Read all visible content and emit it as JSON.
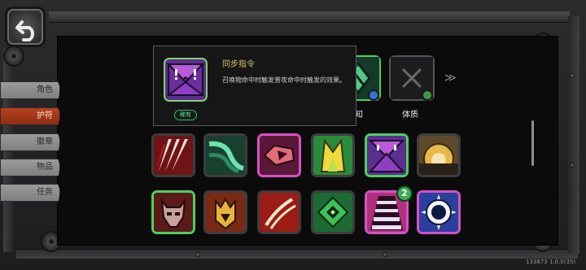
{
  "nav": {
    "tabs": [
      {
        "label": "角色",
        "active": false
      },
      {
        "label": "护符",
        "active": true
      },
      {
        "label": "徽章",
        "active": false
      },
      {
        "label": "物品",
        "active": false
      },
      {
        "label": "任务",
        "active": false
      }
    ]
  },
  "tooltip": {
    "title": "同步指令",
    "description": "召唤物命中时触发普攻命中时触发的效果。",
    "rarity": "稀有",
    "icon": "purple-alert-triangles-icon"
  },
  "top_row": [
    {
      "label": "感知",
      "icon": "green-crystal-icon",
      "badge_icon": "blue-gem-icon"
    },
    {
      "label": "体质",
      "icon": "empty-cross-icon",
      "badge_icon": "green-shield-icon"
    }
  ],
  "grid": {
    "rows": [
      [
        {
          "name": "red-claw-slash-icon",
          "border": "gray"
        },
        {
          "name": "green-dash-icon",
          "border": "gray"
        },
        {
          "name": "pink-burst-fist-icon",
          "border": "pink"
        },
        {
          "name": "yellow-arrows-icon",
          "border": "gray"
        },
        {
          "name": "purple-alert-triangles-icon",
          "border": "green"
        },
        {
          "name": "golden-sun-icon",
          "border": "gray"
        }
      ],
      [
        {
          "name": "demon-skull-icon",
          "border": "green"
        },
        {
          "name": "golden-crown-helm-icon",
          "border": "gray"
        },
        {
          "name": "red-scratch-icon",
          "border": "gray"
        },
        {
          "name": "green-diamond-rune-icon",
          "border": "gray"
        },
        {
          "name": "ladder-stairs-icon",
          "border": "pink",
          "count": "2"
        },
        {
          "name": "spiked-orb-icon",
          "border": "pink"
        }
      ]
    ]
  },
  "version": "133873 1.0.0(35)",
  "colors": {
    "accent_red": "#b8421e",
    "rarity_green": "#3fb66a",
    "title_gold": "#d8c36b"
  }
}
